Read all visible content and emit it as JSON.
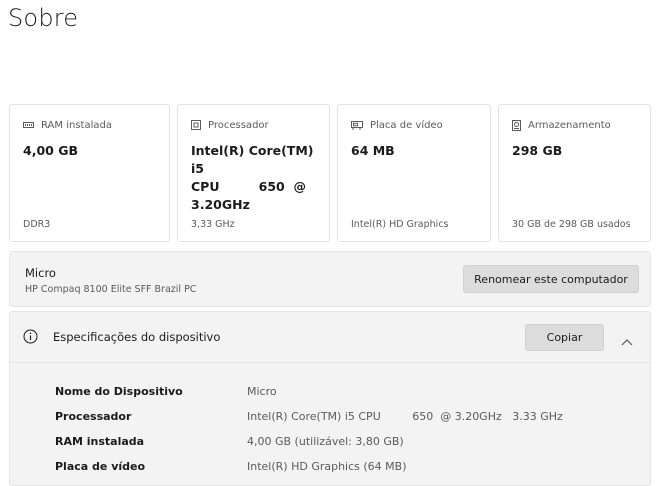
{
  "page": {
    "title": "Sobre"
  },
  "cards": [
    {
      "icon": "ram-icon",
      "label": "RAM instalada",
      "value": "4,00 GB",
      "footer": "DDR3"
    },
    {
      "icon": "processor-icon",
      "label": "Processador",
      "value": "Intel(R) Core(TM) i5\nCPU         650  @\n3.20GHz",
      "footer": "3,33 GHz"
    },
    {
      "icon": "graphics-card-icon",
      "label": "Placa de vídeo",
      "value": "64 MB",
      "footer": "Intel(R) HD Graphics"
    },
    {
      "icon": "storage-icon",
      "label": "Armazenamento",
      "value": "298 GB",
      "footer": "30 GB de 298 GB usados"
    }
  ],
  "device": {
    "name": "Micro",
    "model": "HP Compaq 8100 Elite SFF Brazil PC",
    "rename_label": "Renomear este computador"
  },
  "specs": {
    "title": "Especificações do dispositivo",
    "copy_label": "Copiar",
    "expanded": true,
    "rows": [
      {
        "key": "Nome do Dispositivo",
        "value": "Micro"
      },
      {
        "key": "Processador",
        "value": "Intel(R) Core(TM) i5 CPU         650  @ 3.20GHz   3.33 GHz"
      },
      {
        "key": "RAM instalada",
        "value": "4,00 GB (utilizável: 3,80 GB)"
      },
      {
        "key": "Placa de vídeo",
        "value": "Intel(R) HD Graphics (64 MB)"
      }
    ]
  },
  "colors": {
    "panel_bg": "#f3f3f3",
    "button_bg": "#dcdcdc",
    "border": "#e3e3e3",
    "text_primary": "#1b1b1b",
    "text_secondary": "#5b5b5b"
  }
}
